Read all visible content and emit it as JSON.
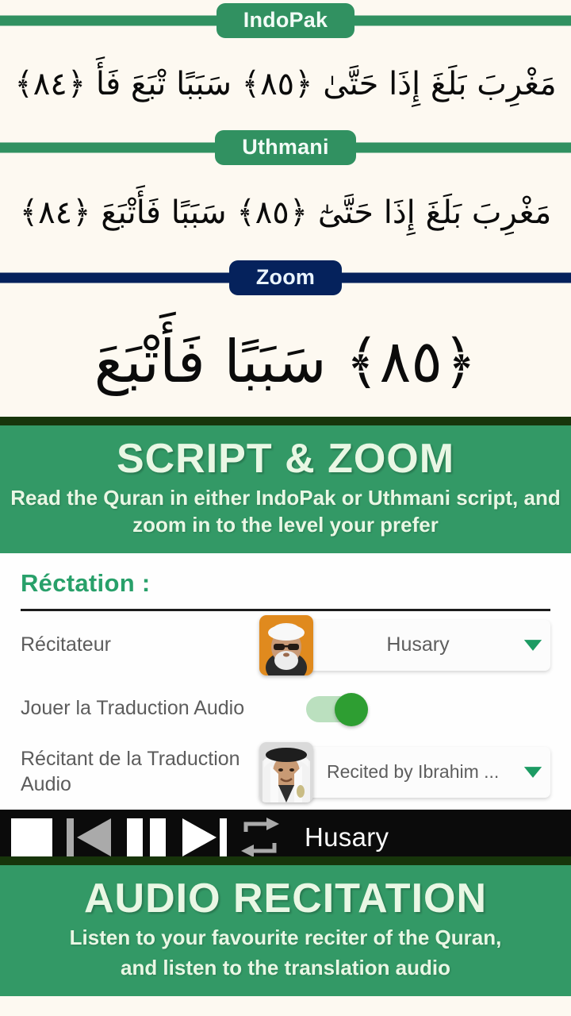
{
  "colors": {
    "green": "#319161",
    "banner_green": "#339966",
    "navy": "#05225C",
    "dark_green_strip": "#17350B",
    "cream_bg": "#FDF9F1",
    "heading_green": "#28A06A",
    "toggle_on": "#2E9E32",
    "player_bg": "#0B0B0B"
  },
  "script_section": {
    "indopak": {
      "label": "IndoPak",
      "arabic": "مَغْرِبَ بَلَغَ إِذَا حَتَّىٰ ﴿٨٥﴾ سَبَبًا تْبَعَ فَأَ ﴿٨٤﴾"
    },
    "uthmani": {
      "label": "Uthmani",
      "arabic": "مَغْرِبَ بَلَغَ إِذَا حَتَّىٰٓ ﴿٨٥﴾ سَبَبًا فَأَتْبَعَ ﴿٨٤﴾"
    },
    "zoom": {
      "label": "Zoom",
      "arabic": "﴿٨٥﴾ سَبَبًا فَأَتْبَعَ"
    }
  },
  "banner_script": {
    "title": "SCRIPT & ZOOM",
    "subtitle": "Read the Quran in either IndoPak or Uthmani script, and zoom in to the level your prefer"
  },
  "settings": {
    "title": "Réctation :",
    "rows": [
      {
        "label": "Récitateur",
        "type": "select",
        "value": "Husary",
        "avatar": "husary-avatar",
        "caret": "chevron-down-icon"
      },
      {
        "label": "Jouer la Traduction Audio",
        "type": "toggle",
        "value": "on"
      },
      {
        "label": "Récitant de la Traduction Audio",
        "type": "select",
        "value": "Recited by Ibrahim ...",
        "avatar": "ibrahim-avatar",
        "caret": "chevron-down-icon"
      }
    ]
  },
  "player": {
    "controls": [
      {
        "name": "stop-button",
        "icon": "stop-icon",
        "state": "enabled"
      },
      {
        "name": "previous-button",
        "icon": "skip-previous-icon",
        "state": "disabled"
      },
      {
        "name": "pause-button",
        "icon": "pause-icon",
        "state": "enabled"
      },
      {
        "name": "next-button",
        "icon": "skip-next-icon",
        "state": "enabled"
      },
      {
        "name": "repeat-button",
        "icon": "repeat-icon",
        "state": "disabled"
      }
    ],
    "title": "Husary"
  },
  "banner_audio": {
    "title": "AUDIO RECITATION",
    "subtitle_line1": "Listen to your favourite reciter of the Quran,",
    "subtitle_line2": "and listen to the translation audio"
  }
}
